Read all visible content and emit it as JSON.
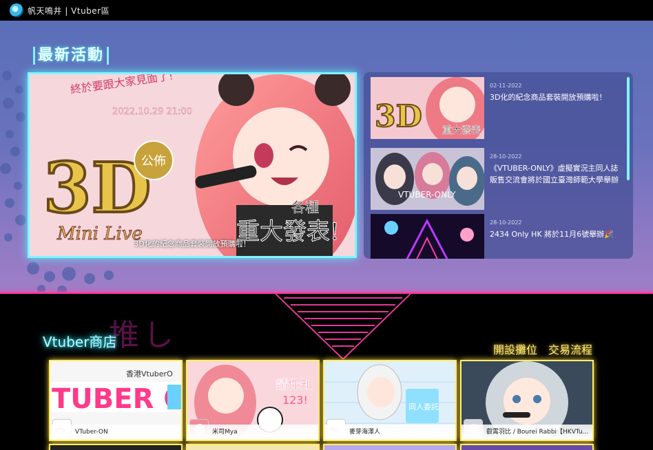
{
  "header": {
    "brand": "帆天鳴井 | Vtuber區"
  },
  "latest": {
    "title": "最新活動",
    "hero": {
      "caption": "3D化的紀念商品套裝開放預購啦！",
      "banner_top": "終於要跟大家見面了!",
      "banner_date": "2022.10.29 21:00",
      "banner_3d": "3D化",
      "banner_announce": "公佈",
      "banner_mini": "Mini Live",
      "banner_various": "各種",
      "banner_big": "重大發表!"
    },
    "news": [
      {
        "date": "02-11-2022",
        "title": "3D化的紀念商品套裝開放預購啦！"
      },
      {
        "date": "28-10-2022",
        "title": "《VTUBER-ONLY》虛擬實況主同人誌販售交流會將於國立臺灣師範大學舉辦"
      },
      {
        "date": "28-10-2022",
        "title": "2434 Only HK 將於11月6號舉辦🎉"
      }
    ]
  },
  "shop": {
    "title": "Vtuber商店",
    "script": "推し",
    "links": [
      "開設攤位",
      "交易流程"
    ],
    "cards": [
      {
        "name": "VTuber-ON",
        "img_text": "TUBER ON",
        "img_sub": "香港VtuberO"
      },
      {
        "name": "米司Mya",
        "img_text": "請你知123!"
      },
      {
        "name": "麥芽海澤人",
        "img_text": "同人委託"
      },
      {
        "name": "叡霄羽比 / Bourei Rabbi【HKVTu...",
        "img_text": ""
      }
    ]
  },
  "colors": {
    "cyan": "#7ff6ff",
    "pink": "#ff3ea8",
    "yellow": "#ffee6a"
  }
}
